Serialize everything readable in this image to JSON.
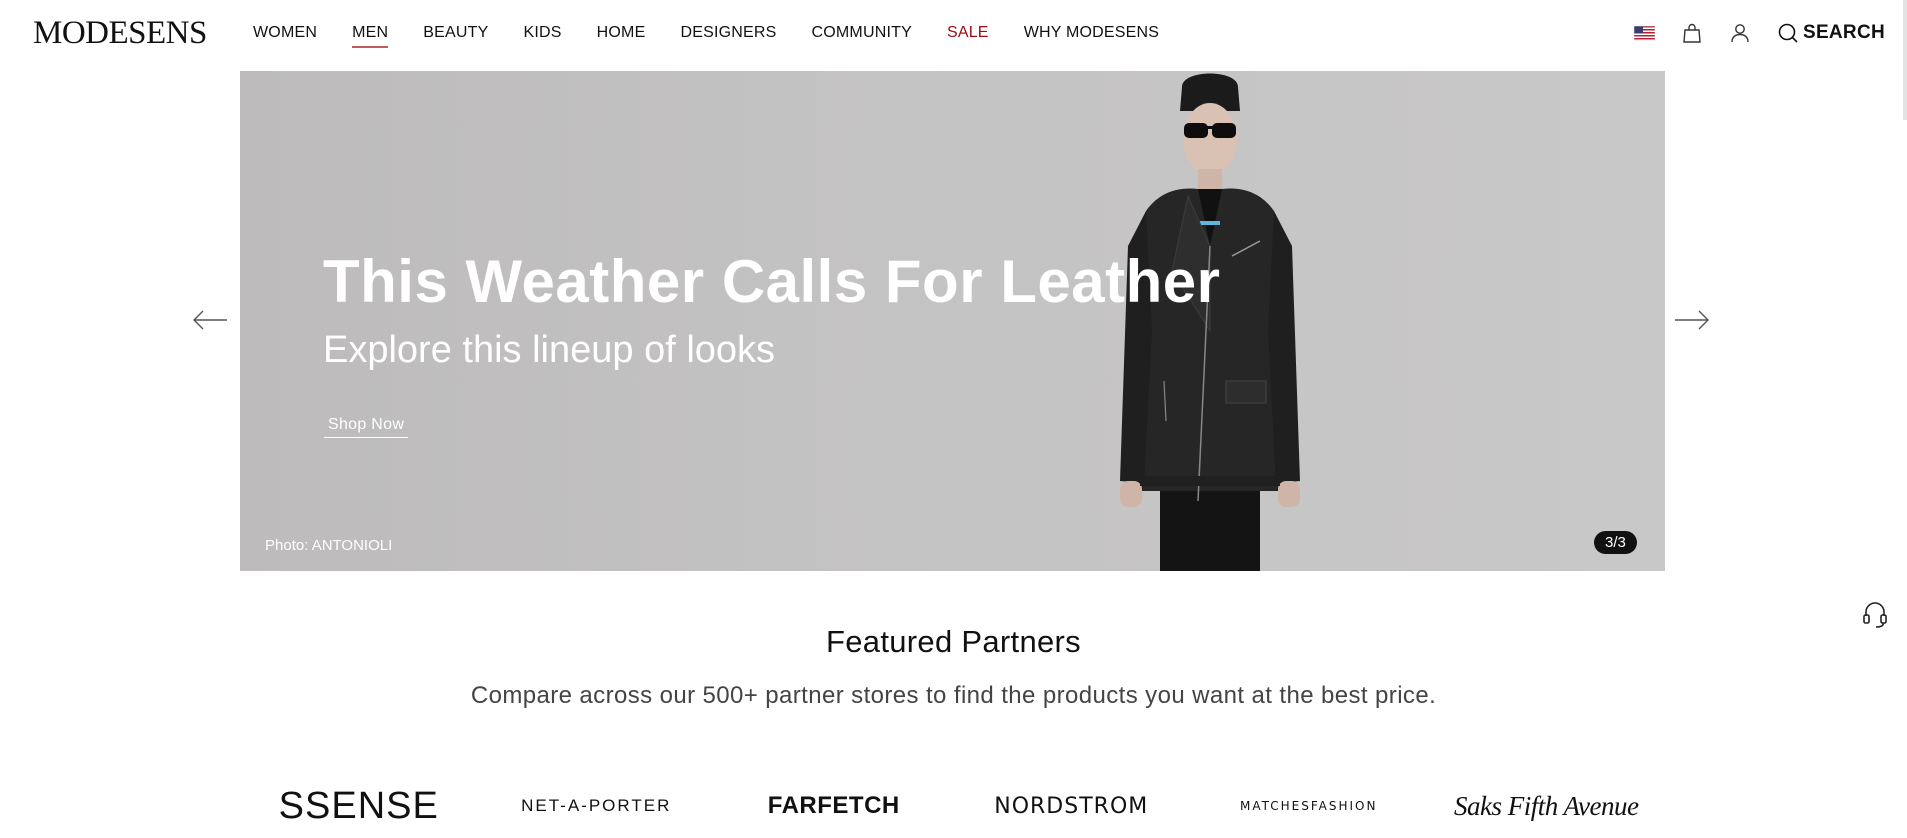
{
  "header": {
    "logo": "MODESENS",
    "nav": [
      {
        "label": "WOMEN"
      },
      {
        "label": "MEN"
      },
      {
        "label": "BEAUTY"
      },
      {
        "label": "KIDS"
      },
      {
        "label": "HOME"
      },
      {
        "label": "DESIGNERS"
      },
      {
        "label": "COMMUNITY"
      },
      {
        "label": "SALE"
      },
      {
        "label": "WHY MODESENS"
      }
    ],
    "active_nav": "MEN",
    "search_label": "SEARCH",
    "icons": [
      "us-flag-icon",
      "shopping-bag-icon",
      "user-icon",
      "search-icon"
    ]
  },
  "hero": {
    "title": "This Weather Calls For Leather",
    "subtitle": "Explore this lineup of looks",
    "cta": "Shop Now",
    "photo_credit": "Photo: ANTONIOLI",
    "slide_counter": "3/3"
  },
  "partners": {
    "title": "Featured Partners",
    "subtitle": "Compare across our 500+ partner stores to find the products you want at the best price.",
    "logos": [
      "SSENSE",
      "NET-A-PORTER",
      "FARFETCH",
      "NORDSTROM",
      "MATCHESFASHION",
      "Saks Fifth Avenue"
    ]
  },
  "colors": {
    "sale": "#9a0c14",
    "active_underline": "#c25a5a",
    "hero_bg": "#c4c3c3",
    "badge_bg": "#111111"
  }
}
